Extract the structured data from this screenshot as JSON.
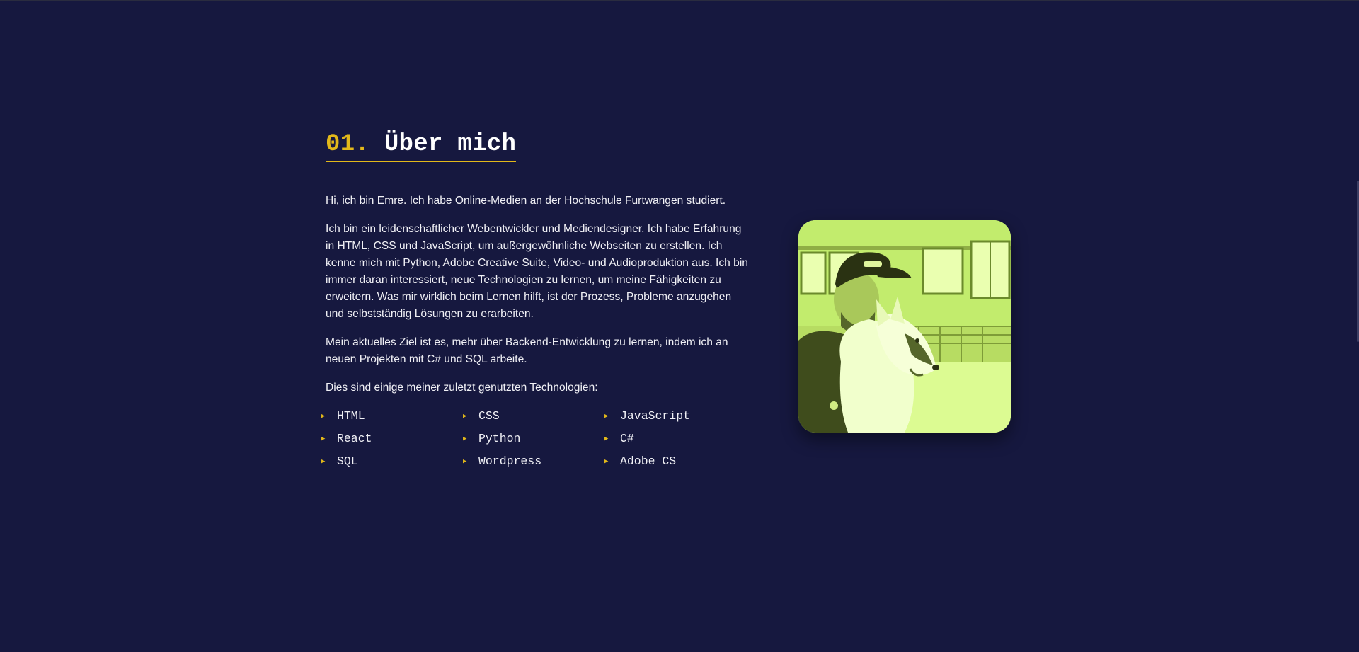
{
  "about": {
    "number": "01.",
    "title": "Über mich",
    "paragraphs": [
      "Hi, ich bin Emre. Ich habe Online-Medien an der Hochschule Furtwangen studiert.",
      "Ich bin ein leidenschaftlicher Webentwickler und Mediendesigner. Ich habe Erfahrung in HTML, CSS und JavaScript, um außergewöhnliche Webseiten zu erstellen. Ich kenne mich mit Python, Adobe Creative Suite, Video- und Audioproduktion aus. Ich bin immer daran interessiert, neue Technologien zu lernen, um meine Fähigkeiten zu erweitern. Was mir wirklich beim Lernen hilft, ist der Prozess, Probleme anzugehen und selbstständig Lösungen zu erarbeiten.",
      "Mein aktuelles Ziel ist es, mehr über Backend-Entwicklung zu lernen, indem ich an neuen Projekten mit C# und SQL arbeite.",
      "Dies sind einige meiner zuletzt genutzten Technologien:"
    ],
    "skills": [
      "HTML",
      "CSS",
      "JavaScript",
      "React",
      "Python",
      "C#",
      "SQL",
      "Wordpress",
      "Adobe CS"
    ],
    "bullet_icon": "triangle-right-icon"
  },
  "colors": {
    "background": "#16183f",
    "accent": "#e2b81a",
    "text": "#f0f0f5",
    "photo_tint": "#ccf57a"
  }
}
